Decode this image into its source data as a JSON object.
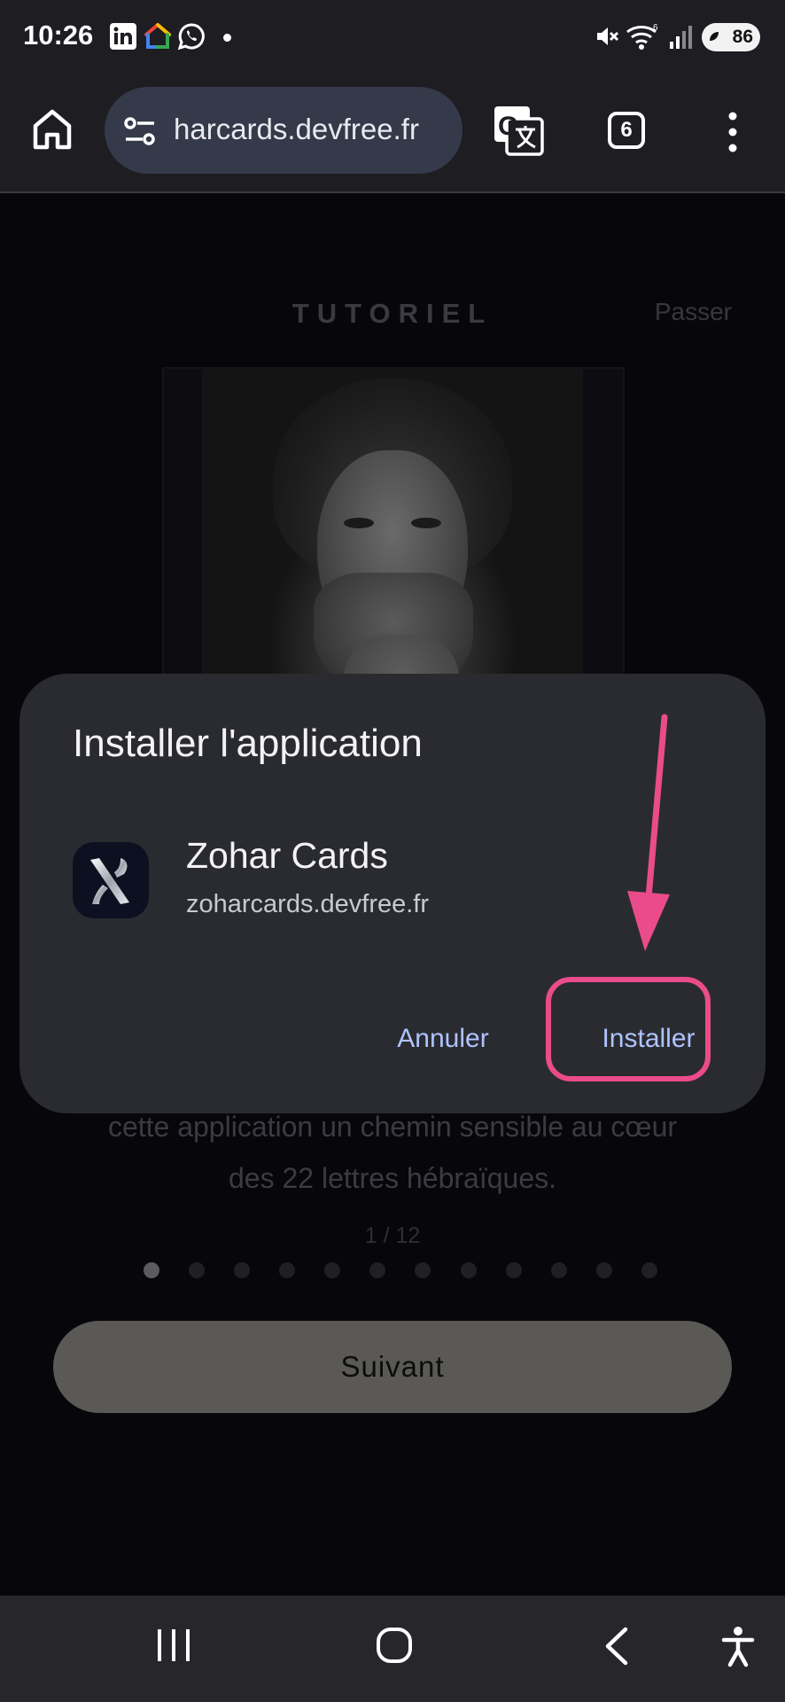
{
  "status_bar": {
    "time": "10:26",
    "notification_icons": [
      "linkedin-icon",
      "google-home-icon",
      "whatsapp-icon"
    ],
    "system_icons": [
      "mute-icon",
      "wifi-icon",
      "signal-icon"
    ],
    "battery": "86"
  },
  "browser": {
    "url": "harcards.devfree.fr",
    "tab_count": "6",
    "icons": [
      "home-icon",
      "site-settings-icon",
      "translate-icon",
      "menu-icon"
    ]
  },
  "page": {
    "title": "TUTORIEL",
    "skip_label": "Passer",
    "body_text": "cette application un chemin sensible au cœur\ndes 22 lettres hébraïques.",
    "counter": "1 / 12",
    "total_dots": 12,
    "active_dot": 0,
    "next_label": "Suivant"
  },
  "dialog": {
    "title": "Installer l'application",
    "app_name": "Zohar Cards",
    "app_url": "zoharcards.devfree.fr",
    "cancel_label": "Annuler",
    "install_label": "Installer",
    "accent_color": "#aec4ff",
    "highlight_color": "#ea4c8b"
  },
  "nav_bar": {
    "icons": [
      "recents-icon",
      "home-circle-icon",
      "back-icon",
      "accessibility-icon"
    ]
  }
}
